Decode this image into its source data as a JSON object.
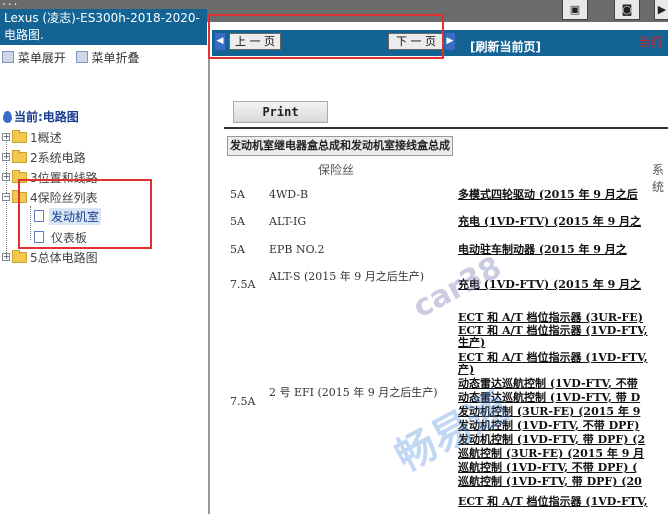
{
  "window": {
    "title_fragment": "..."
  },
  "toolbar": {
    "icons": [
      "page-icon",
      "binoculars-icon",
      "exit-icon"
    ]
  },
  "left_panel": {
    "header_title": "Lexus (凌志)-ES300h-2018-2020- 电路图.",
    "menu_expand": "菜单展开",
    "menu_collapse": "菜单折叠",
    "current_label": "当前:电路图",
    "tree": [
      {
        "label": "1概述"
      },
      {
        "label": "2系统电路"
      },
      {
        "label": "3位置和线路"
      },
      {
        "label": "4保险丝列表"
      },
      {
        "label": "发动机室"
      },
      {
        "label": "仪表板"
      },
      {
        "label": "5总体电路图"
      }
    ]
  },
  "nav": {
    "prev_label": "上 一 页",
    "next_label": "下 一 页",
    "refresh_label": "[刷新当前页]",
    "current_fragment": "当前"
  },
  "content": {
    "print_label": "Print",
    "section_title": "发动机室继电器盒总成和发动机室接线盒总成",
    "col_fuse": "保险丝",
    "col_system": "系统",
    "rows": [
      {
        "amp": "5A",
        "fuse": "4WD-B",
        "circuits": [
          "多模式四轮驱动 (2015 年 9 月之后"
        ]
      },
      {
        "amp": "5A",
        "fuse": "ALT-IG",
        "circuits": [
          "充电 (1VD-FTV) (2015 年 9 月之"
        ]
      },
      {
        "amp": "5A",
        "fuse": "EPB NO.2",
        "circuits": [
          "电动驻车制动器 (2015 年 9 月之"
        ]
      },
      {
        "amp": "7.5A",
        "fuse": "ALT-S (2015 年 9 月之后生产)",
        "circuits": [
          "充电 (1VD-FTV) (2015 年 9 月之"
        ]
      },
      {
        "amp": "7.5A",
        "fuse": "2 号 EFI (2015 年 9 月之后生产)",
        "circuits": [
          "ECT 和 A/T 档位指示器 (3UR-FE)",
          "ECT 和 A/T 档位指示器 (1VD-FTV,",
          "生产)",
          "ECT 和 A/T 档位指示器 (1VD-FTV,",
          "产)",
          "动态雷达巡航控制 (1VD-FTV, 不带",
          "动态雷达巡航控制 (1VD-FTV, 带 D",
          "发动机控制 (3UR-FE) (2015 年 9",
          "发动机控制 (1VD-FTV, 不带 DPF)",
          "发动机控制 (1VD-FTV, 带 DPF) (2",
          "巡航控制 (3UR-FE) (2015 年 9 月",
          "巡航控制 (1VD-FTV, 不带 DPF) (",
          "巡航控制 (1VD-FTV, 带 DPF) (20",
          "ECT 和 A/T 档位指示器 (1VD-FTV,"
        ]
      }
    ]
  },
  "watermark": {
    "text1": "car38",
    "text2": "畅易通"
  }
}
